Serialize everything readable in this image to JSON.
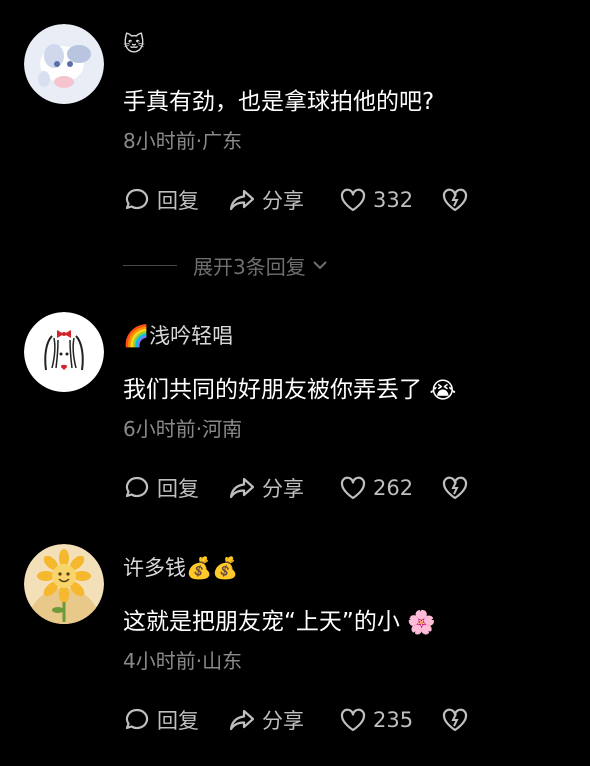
{
  "comments": [
    {
      "username": "🐱",
      "text": "手真有劲，也是拿球拍他的吧?",
      "meta": "8小时前·广东",
      "reply_label": "回复",
      "share_label": "分享",
      "likes": "332"
    },
    {
      "username": "🌈浅吟轻唱",
      "text": "我们共同的好朋友被你弄丢了",
      "text_emoji": "😭",
      "meta": "6小时前·河南",
      "reply_label": "回复",
      "share_label": "分享",
      "likes": "262"
    },
    {
      "username": "许多钱💰💰",
      "text": "这就是把朋友宠“上天”的小",
      "text_emoji": "🌸",
      "meta": "4小时前·山东",
      "reply_label": "回复",
      "share_label": "分享",
      "likes": "235"
    }
  ],
  "expand_replies": {
    "label": "展开3条回复"
  }
}
